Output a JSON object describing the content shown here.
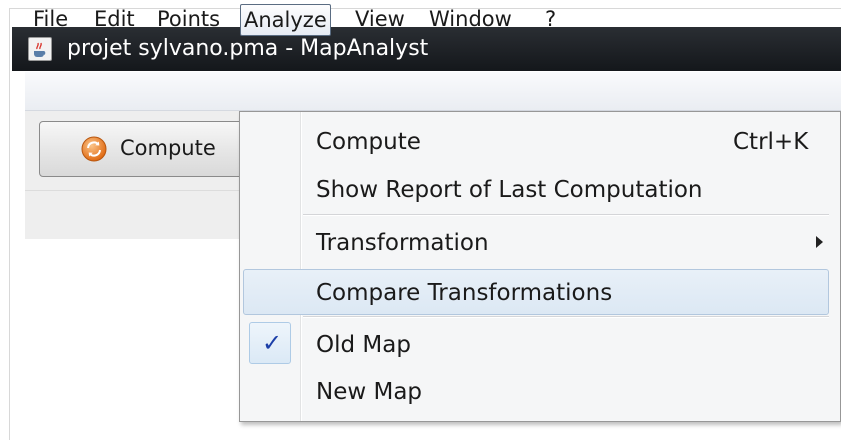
{
  "window": {
    "title": "projet sylvano.pma - MapAnalyst",
    "app_icon": "java-cup-icon"
  },
  "menubar": {
    "items": [
      {
        "label": "File"
      },
      {
        "label": "Edit"
      },
      {
        "label": "Points"
      },
      {
        "label": "Analyze",
        "active": true
      },
      {
        "label": "View"
      },
      {
        "label": "Window"
      },
      {
        "label": "?"
      }
    ]
  },
  "toolbar": {
    "compute_label": "Compute",
    "compute_icon": "refresh-icon"
  },
  "analyze_menu": {
    "items": [
      {
        "label": "Compute",
        "accelerator": "Ctrl+K"
      },
      {
        "label": "Show Report of Last Computation"
      },
      {
        "label": "Transformation",
        "submenu": true
      },
      {
        "label": "Compare Transformations",
        "highlighted": true
      },
      {
        "label": "Old Map",
        "checked": true
      },
      {
        "label": "New Map"
      }
    ]
  },
  "colors": {
    "titlebar": "#1b1e22",
    "highlight": "#dce8f4",
    "check": "#1c3fa8",
    "icon_orange": "#e87722"
  }
}
